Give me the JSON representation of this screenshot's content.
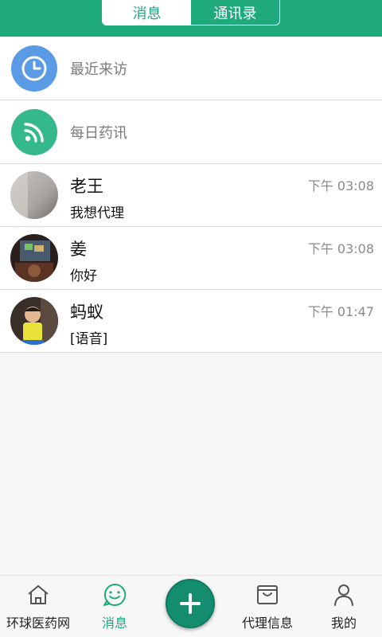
{
  "header": {
    "tabs": [
      {
        "label": "消息",
        "active": true
      },
      {
        "label": "通讯录",
        "active": false
      }
    ]
  },
  "shortcuts": [
    {
      "label": "最近来访",
      "icon": "clock-icon",
      "color": "#5b9be6"
    },
    {
      "label": "每日药讯",
      "icon": "rss-icon",
      "color": "#35b98a"
    }
  ],
  "chats": [
    {
      "name": "老王",
      "time": "下午 03:08",
      "message": "我想代理"
    },
    {
      "name": "姜",
      "time": "下午 03:08",
      "message": "你好"
    },
    {
      "name": "蚂蚁",
      "time": "下午 01:47",
      "message": "[语音]"
    }
  ],
  "nav": {
    "items": [
      {
        "label": "环球医药网",
        "icon": "home-icon"
      },
      {
        "label": "消息",
        "icon": "smile-chat-icon",
        "active": true
      },
      {
        "label": "代理信息",
        "icon": "bag-icon"
      },
      {
        "label": "我的",
        "icon": "person-icon"
      }
    ],
    "fab_icon": "plus-icon"
  },
  "colors": {
    "brand": "#1faa7e",
    "fab": "#148c6e"
  }
}
